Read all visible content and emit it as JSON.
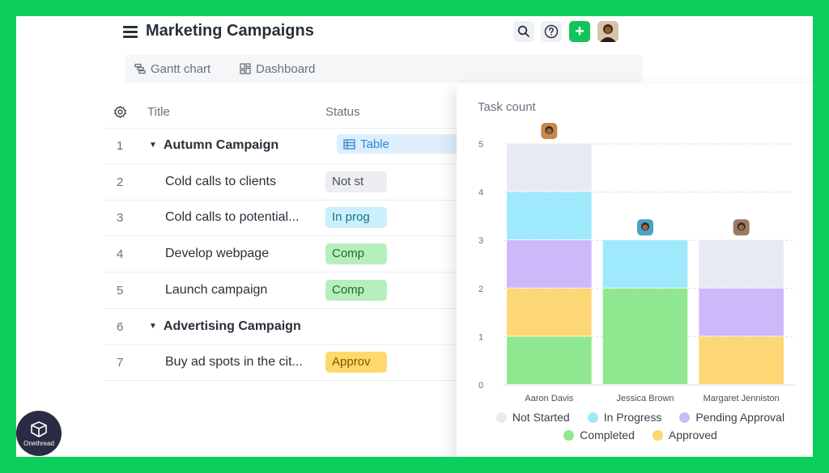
{
  "app": {
    "title": "Marketing Campaigns",
    "accent_color": "#12c45a"
  },
  "header": {
    "icons": [
      "menu-icon",
      "search-icon",
      "help-icon",
      "add-icon",
      "user-avatar"
    ],
    "add_label": "+"
  },
  "tabs": [
    {
      "label": "Gantt chart",
      "icon": "gantt-icon",
      "active": false
    },
    {
      "label": "Dashboard",
      "icon": "dashboard-icon",
      "active": false
    },
    {
      "label": "Table",
      "icon": "table-icon",
      "active": true
    }
  ],
  "table": {
    "columns": [
      "Title",
      "Status"
    ],
    "rows": [
      {
        "num": "1",
        "title": "Autumn Campaign",
        "group": true,
        "status": "",
        "status_color": ""
      },
      {
        "num": "2",
        "title": "Cold calls to clients",
        "group": false,
        "status": "Not st",
        "status_color": "#eceef2",
        "status_text_color": "#4b4f5a"
      },
      {
        "num": "3",
        "title": "Cold calls to potential...",
        "group": false,
        "status": "In prog",
        "status_color": "#c9f0fb",
        "status_text_color": "#1f6f8a"
      },
      {
        "num": "4",
        "title": "Develop webpage",
        "group": false,
        "status": "Comp",
        "status_color": "#b5efbd",
        "status_text_color": "#1f6b2d"
      },
      {
        "num": "5",
        "title": "Launch campaign",
        "group": false,
        "status": "Comp",
        "status_color": "#b5efbd",
        "status_text_color": "#1f6b2d"
      },
      {
        "num": "6",
        "title": "Advertising Campaign",
        "group": true,
        "status": "",
        "status_color": ""
      },
      {
        "num": "7",
        "title": "Buy ad spots in the cit...",
        "group": false,
        "status": "Approv",
        "status_color": "#ffd86b",
        "status_text_color": "#7a5a00"
      }
    ]
  },
  "chart_data": {
    "type": "bar",
    "stacked": true,
    "title": "Task count",
    "categories": [
      "Aaron Davis",
      "Jessica Brown",
      "Margaret Jenniston"
    ],
    "series": [
      {
        "name": "Completed",
        "color": "#8fe88f",
        "values": [
          1,
          2,
          0
        ]
      },
      {
        "name": "Approved",
        "color": "#fdd776",
        "values": [
          1,
          0,
          1
        ]
      },
      {
        "name": "Pending Approval",
        "color": "#cdb8fa",
        "values": [
          1,
          0,
          1
        ]
      },
      {
        "name": "In Progress",
        "color": "#9ee9fb",
        "values": [
          1,
          1,
          0
        ]
      },
      {
        "name": "Not Started",
        "color": "#e8eaf2",
        "values": [
          1,
          0,
          1
        ]
      }
    ],
    "ylim": [
      0,
      5
    ],
    "yticks": [
      "0",
      "1",
      "2",
      "3",
      "4",
      "5"
    ],
    "grid": true,
    "legend_placement": "bottom",
    "legend_rows": [
      [
        "Not Started",
        "In Progress",
        "Pending Approval"
      ],
      [
        "Completed",
        "Approved"
      ]
    ]
  },
  "brand": {
    "name": "Onethread",
    "icon": "onethread-logo-icon"
  }
}
